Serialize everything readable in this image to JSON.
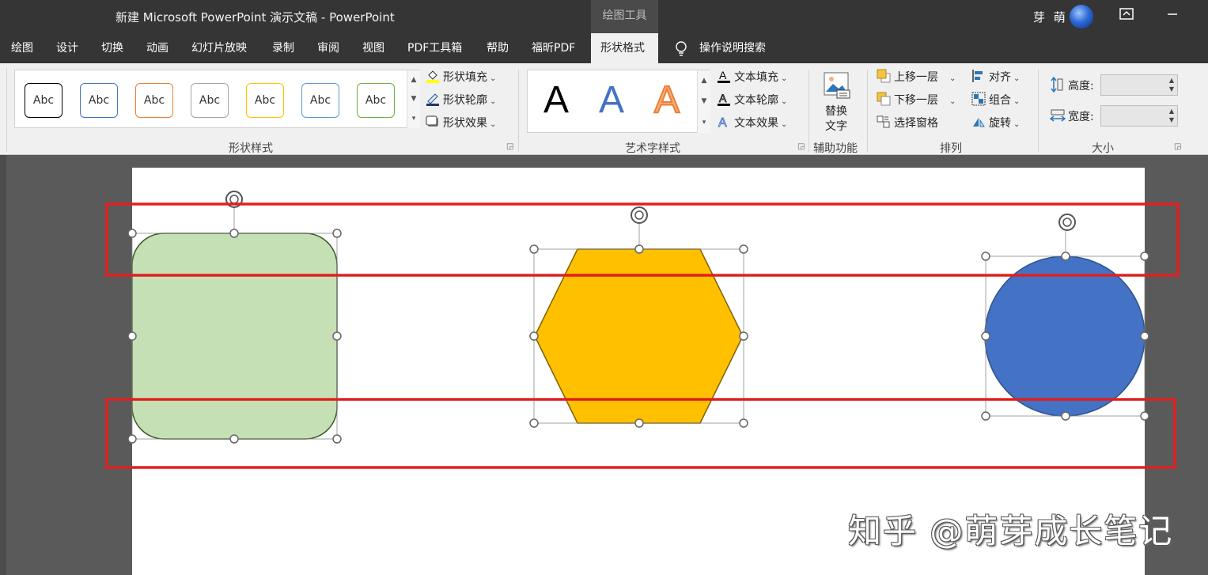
{
  "window": {
    "title": "新建 Microsoft PowerPoint 演示文稿  -  PowerPoint",
    "context_tool": "绘图工具",
    "user": "芽 萌"
  },
  "tabs": [
    "绘图",
    "设计",
    "切换",
    "动画",
    "幻灯片放映",
    "录制",
    "审阅",
    "视图",
    "PDF工具箱",
    "帮助",
    "福昕PDF",
    "形状格式"
  ],
  "active_tab": "形状格式",
  "search_label": "操作说明搜索",
  "ribbon": {
    "shape_styles": {
      "label": "形状样式",
      "gallery": [
        {
          "text": "Abc",
          "border": "#000000"
        },
        {
          "text": "Abc",
          "border": "#4472c4"
        },
        {
          "text": "Abc",
          "border": "#ed7d31"
        },
        {
          "text": "Abc",
          "border": "#a5a5a5"
        },
        {
          "text": "Abc",
          "border": "#ffc000"
        },
        {
          "text": "Abc",
          "border": "#5b9bd5"
        },
        {
          "text": "Abc",
          "border": "#70ad47"
        }
      ],
      "fill": "形状填充",
      "outline": "形状轮廓",
      "effects": "形状效果"
    },
    "wordart_styles": {
      "label": "艺术字样式",
      "samples": [
        "A",
        "A",
        "A"
      ],
      "text_fill": "文本填充",
      "text_outline": "文本轮廓",
      "text_effects": "文本效果"
    },
    "accessibility": {
      "label": "辅助功能",
      "alt_text_line1": "替换",
      "alt_text_line2": "文字"
    },
    "arrange": {
      "label": "排列",
      "bring_forward": "上移一层",
      "send_backward": "下移一层",
      "selection_pane": "选择窗格",
      "align": "对齐",
      "group": "组合",
      "rotate": "旋转"
    },
    "size": {
      "label": "大小",
      "height_label": "高度:",
      "width_label": "宽度:",
      "height_value": "",
      "width_value": ""
    }
  },
  "slide": {
    "shapes": [
      {
        "name": "rounded-rectangle",
        "fill": "#c5e0b4",
        "stroke": "#385723"
      },
      {
        "name": "hexagon",
        "fill": "#ffc000",
        "stroke": "#7f6000"
      },
      {
        "name": "circle",
        "fill": "#4472c4",
        "stroke": "#2f528f"
      }
    ],
    "highlight_color": "#e02020"
  },
  "watermark": "知乎 @萌芽成长笔记"
}
